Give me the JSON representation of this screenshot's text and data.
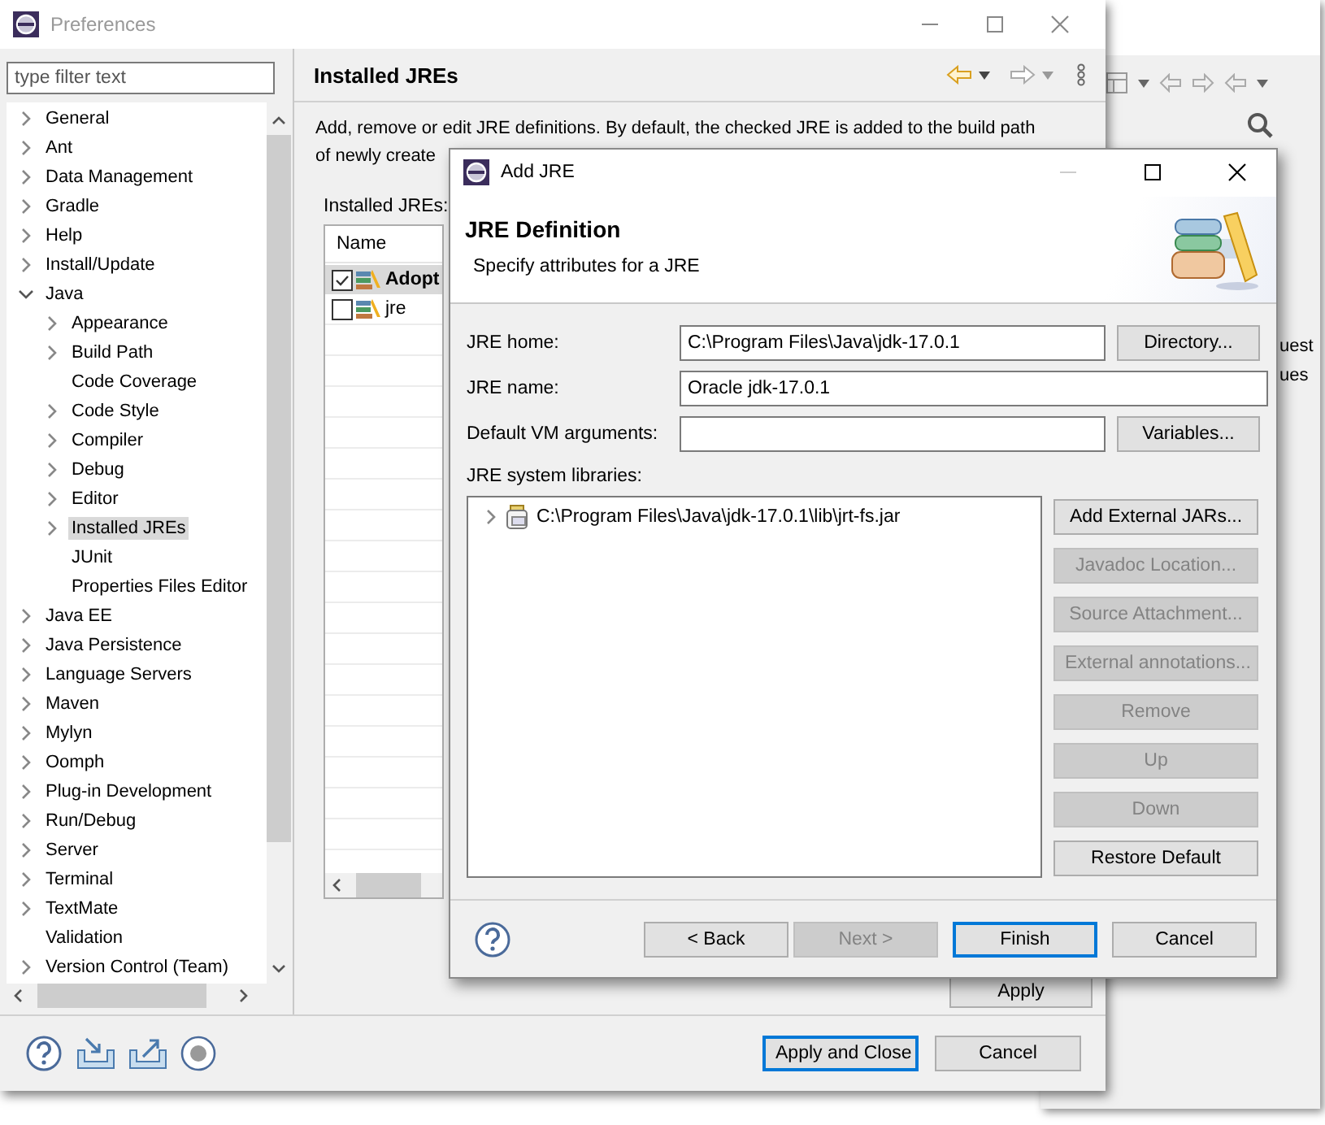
{
  "background_window": {
    "text_fragments": [
      "uest",
      "ues"
    ]
  },
  "preferences_window": {
    "title": "Preferences",
    "filter": {
      "placeholder": "type filter text"
    },
    "tree": [
      {
        "label": "General",
        "expanded": false,
        "selected": false
      },
      {
        "label": "Ant",
        "expanded": false,
        "selected": false
      },
      {
        "label": "Data Management",
        "expanded": false,
        "selected": false
      },
      {
        "label": "Gradle",
        "expanded": false,
        "selected": false
      },
      {
        "label": "Help",
        "expanded": false,
        "selected": false
      },
      {
        "label": "Install/Update",
        "expanded": false,
        "selected": false
      },
      {
        "label": "Java",
        "expanded": true,
        "selected": false,
        "children": [
          {
            "label": "Appearance",
            "expanded": false,
            "selected": false
          },
          {
            "label": "Build Path",
            "expanded": false,
            "selected": false
          },
          {
            "label": "Code Coverage",
            "selected": false
          },
          {
            "label": "Code Style",
            "expanded": false,
            "selected": false
          },
          {
            "label": "Compiler",
            "expanded": false,
            "selected": false
          },
          {
            "label": "Debug",
            "expanded": false,
            "selected": false
          },
          {
            "label": "Editor",
            "expanded": false,
            "selected": false
          },
          {
            "label": "Installed JREs",
            "expanded": false,
            "selected": true
          },
          {
            "label": "JUnit",
            "selected": false
          },
          {
            "label": "Properties Files Editor",
            "selected": false
          }
        ]
      },
      {
        "label": "Java EE",
        "expanded": false,
        "selected": false
      },
      {
        "label": "Java Persistence",
        "expanded": false,
        "selected": false
      },
      {
        "label": "Language Servers",
        "expanded": false,
        "selected": false
      },
      {
        "label": "Maven",
        "expanded": false,
        "selected": false
      },
      {
        "label": "Mylyn",
        "expanded": false,
        "selected": false
      },
      {
        "label": "Oomph",
        "expanded": false,
        "selected": false
      },
      {
        "label": "Plug-in Development",
        "expanded": false,
        "selected": false
      },
      {
        "label": "Run/Debug",
        "expanded": false,
        "selected": false
      },
      {
        "label": "Server",
        "expanded": false,
        "selected": false
      },
      {
        "label": "Terminal",
        "expanded": false,
        "selected": false
      },
      {
        "label": "TextMate",
        "expanded": false,
        "selected": false
      },
      {
        "label": "Validation",
        "selected": false
      },
      {
        "label": "Version Control (Team)",
        "expanded": false,
        "selected": false
      }
    ],
    "page": {
      "title": "Installed JREs",
      "description_lines": [
        "Add, remove or edit JRE definitions. By default, the checked JRE is added to the build path",
        "of newly create"
      ],
      "table_label": "Installed JREs:",
      "table": {
        "columns": [
          "Name"
        ],
        "rows": [
          {
            "name": "Adopt",
            "checked": true,
            "selected": true
          },
          {
            "name": "jre",
            "checked": false,
            "selected": false
          }
        ]
      },
      "apply_button": "Apply"
    },
    "buttons": [
      {
        "label": "Apply and Close",
        "default": true
      },
      {
        "label": "Cancel",
        "default": false
      }
    ]
  },
  "dialog": {
    "title": "Add JRE",
    "heading": "JRE Definition",
    "subtitle": "Specify attributes for a JRE",
    "fields": [
      {
        "label": "JRE home:",
        "value": "C:\\Program Files\\Java\\jdk-17.0.1",
        "button": "Directory..."
      },
      {
        "label": "JRE name:",
        "value": "Oracle jdk-17.0.1"
      },
      {
        "label": "Default VM arguments:",
        "button": "Variables..."
      }
    ],
    "libraries_label": "JRE system libraries:",
    "libraries": [
      {
        "label": "C:\\Program Files\\Java\\jdk-17.0.1\\lib\\jrt-fs.jar",
        "expanded": false
      }
    ],
    "library_buttons": [
      {
        "label": "Add External JARs...",
        "disabled": false
      },
      {
        "label": "Javadoc Location...",
        "disabled": true
      },
      {
        "label": "Source Attachment...",
        "disabled": true
      },
      {
        "label": "External annotations...",
        "disabled": true
      },
      {
        "label": "Remove",
        "disabled": true
      },
      {
        "label": "Up",
        "disabled": true
      },
      {
        "label": "Down",
        "disabled": true
      },
      {
        "label": "Restore Default",
        "disabled": false
      }
    ],
    "nav_buttons": [
      {
        "label": "< Back",
        "disabled": false,
        "default": false
      },
      {
        "label": "Next >",
        "disabled": true,
        "default": false
      },
      {
        "label": "Finish",
        "disabled": false,
        "default": true
      },
      {
        "label": "Cancel",
        "disabled": false,
        "default": false
      }
    ]
  }
}
